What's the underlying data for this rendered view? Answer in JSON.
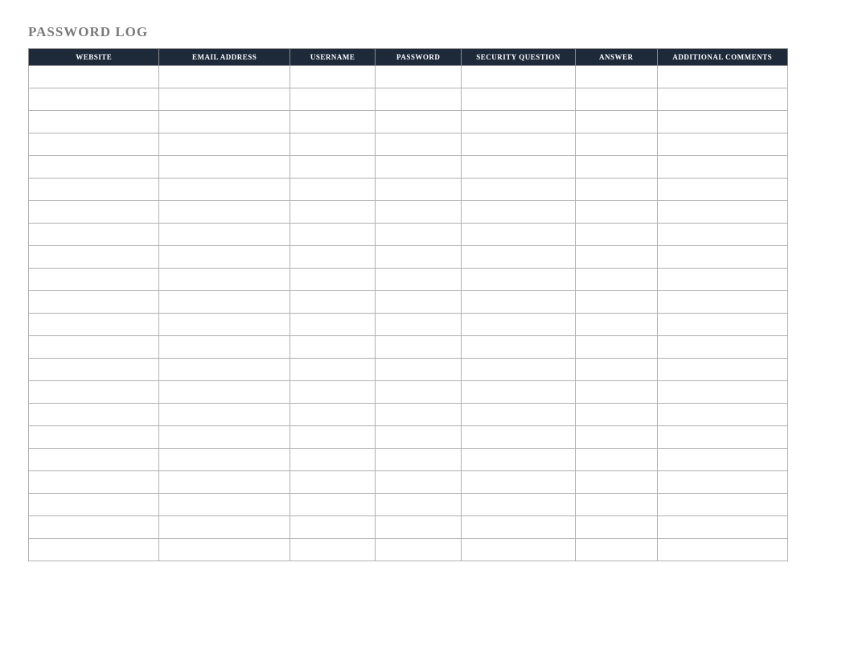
{
  "title": "PASSWORD LOG",
  "columns": [
    {
      "label": "WEBSITE",
      "class": "c-website",
      "shade": ""
    },
    {
      "label": "EMAIL ADDRESS",
      "class": "c-email",
      "shade": "shade-gray"
    },
    {
      "label": "USERNAME",
      "class": "c-username",
      "shade": "shade-blue"
    },
    {
      "label": "PASSWORD",
      "class": "c-password",
      "shade": "shade-blue"
    },
    {
      "label": "SECURITY QUESTION",
      "class": "c-question",
      "shade": "shade-gray"
    },
    {
      "label": "ANSWER",
      "class": "c-answer",
      "shade": "shade-gray"
    },
    {
      "label": "ADDITIONAL COMMENTS",
      "class": "c-comments",
      "shade": ""
    }
  ],
  "row_count": 22,
  "rows": []
}
